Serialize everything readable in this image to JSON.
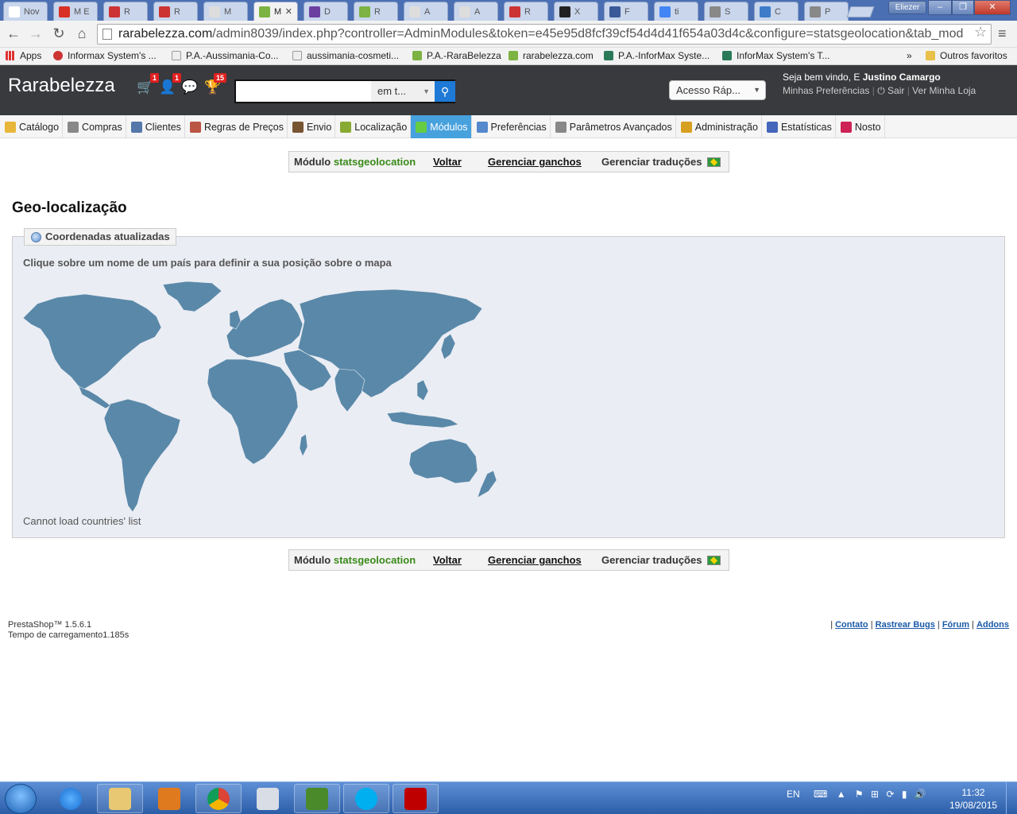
{
  "browser": {
    "tabs": [
      {
        "label": "Nov",
        "color": "#ffffff"
      },
      {
        "label": "M E",
        "color": "#d93025"
      },
      {
        "label": "R",
        "color": "#cc3333"
      },
      {
        "label": "R",
        "color": "#cc3333"
      },
      {
        "label": "M",
        "color": "#dddddd"
      },
      {
        "label": "M",
        "color": "#7cb342",
        "active": true
      },
      {
        "label": "D",
        "color": "#6b3fa0"
      },
      {
        "label": "R",
        "color": "#7cb342"
      },
      {
        "label": "A",
        "color": "#dddddd"
      },
      {
        "label": "A",
        "color": "#dddddd"
      },
      {
        "label": "R",
        "color": "#cc3333"
      },
      {
        "label": "X",
        "color": "#222222"
      },
      {
        "label": "F",
        "color": "#3b5998"
      },
      {
        "label": "ti",
        "color": "#4285f4"
      },
      {
        "label": "S",
        "color": "#888888"
      },
      {
        "label": "C",
        "color": "#3d7cc9"
      },
      {
        "label": "P",
        "color": "#888888"
      }
    ],
    "user": "Eliezer",
    "url_host": "rarabelezza.com",
    "url_path": "/admin8039/index.php?controller=AdminModules&token=e45e95d8fcf39cf54d4d41f654a03d4c&configure=statsgeolocation&tab_mod",
    "bookmarks": [
      {
        "label": "Apps"
      },
      {
        "label": "Informax System's ..."
      },
      {
        "label": "P.A.-Aussimania-Co..."
      },
      {
        "label": "aussimania-cosmeti..."
      },
      {
        "label": "P.A.-RaraBelezza"
      },
      {
        "label": "rarabelezza.com"
      },
      {
        "label": "P.A.-InforMax Syste..."
      },
      {
        "label": "InforMax System's T..."
      }
    ],
    "bookmarks_more": "»",
    "other_bookmarks": "Outros favoritos"
  },
  "header": {
    "shop_name": "Rarabelezza",
    "badge_orders": "1",
    "badge_customers": "1",
    "badge_messages": "",
    "badge_trophy": "15",
    "search_value": "",
    "search_scope": "em t...",
    "quick_access": "Acesso Ráp...",
    "welcome_prefix": "Seja bem vindo, E",
    "welcome_name": "Justino Camargo",
    "link_prefs": "Minhas Preferências",
    "link_logout": "Sair",
    "link_shop": "Ver Minha Loja"
  },
  "menu": [
    {
      "label": "Catálogo",
      "color": "#e8b73a"
    },
    {
      "label": "Compras",
      "color": "#888888"
    },
    {
      "label": "Clientes",
      "color": "#5577aa"
    },
    {
      "label": "Regras de Preços",
      "color": "#bb5544"
    },
    {
      "label": "Envio",
      "color": "#775533"
    },
    {
      "label": "Localização",
      "color": "#88aa33"
    },
    {
      "label": "Módulos",
      "color": "#66cc44",
      "active": true
    },
    {
      "label": "Preferências",
      "color": "#5588cc"
    },
    {
      "label": "Parâmetros Avançados",
      "color": "#888888"
    },
    {
      "label": "Administração",
      "color": "#d8a020"
    },
    {
      "label": "Estatísticas",
      "color": "#4466bb"
    },
    {
      "label": "Nosto",
      "color": "#cc2255"
    }
  ],
  "module_bar": {
    "prefix": "Módulo",
    "module_name": "statsgeolocation",
    "back": "Voltar",
    "hooks": "Gerenciar ganchos",
    "translations": "Gerenciar traduções"
  },
  "content": {
    "title": "Geo-localização",
    "legend": "Coordenadas atualizadas",
    "instruction": "Clique sobre um nome de um país para definir a sua posição sobre o mapa",
    "error": "Cannot load countries' list",
    "map_color": "#5a88a8"
  },
  "footer": {
    "version": "PrestaShop™ 1.5.6.1",
    "load_time": "Tempo de carregamento1.185s",
    "sep": "|",
    "contact": "Contato",
    "bugs": "Rastrear Bugs",
    "forum": "Fórum",
    "addons": "Addons"
  },
  "taskbar": {
    "apps": [
      "internet-explorer",
      "file-explorer",
      "media-player",
      "chrome",
      "calculator",
      "wifi-app",
      "skype",
      "filezilla"
    ],
    "lang": "EN",
    "time": "11:32",
    "date": "19/08/2015"
  }
}
